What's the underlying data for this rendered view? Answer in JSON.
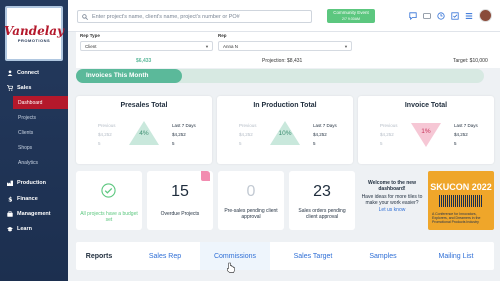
{
  "brand": {
    "logo_line1": "Vandelay",
    "logo_line2": "PROMOTIONS"
  },
  "sidebar": {
    "items": [
      {
        "label": "Connect",
        "icon": "user-icon"
      },
      {
        "label": "Sales",
        "icon": "cart-icon"
      },
      {
        "label": "Production",
        "icon": "factory-icon"
      },
      {
        "label": "Finance",
        "icon": "dollar-icon"
      },
      {
        "label": "Management",
        "icon": "briefcase-icon"
      },
      {
        "label": "Learn",
        "icon": "graduation-icon"
      }
    ],
    "sales_sub": [
      "Dashboard",
      "Projects",
      "Clients",
      "Shops",
      "Analytics"
    ]
  },
  "topbar": {
    "search_placeholder": "Enter project's name, client's name, project's number or PO#",
    "event_button": "Community Event",
    "event_sub": "2/7 9:30AM"
  },
  "filters": {
    "rep_type_label": "Rep Type",
    "rep_type_value": "Client",
    "rep_label": "Rep",
    "rep_value": "Anna N",
    "amount_left": "$6,433",
    "projection": "Projection: $8,431",
    "target": "Target: $10,000"
  },
  "progress": {
    "label": "Invoices This Month",
    "value": 0.26
  },
  "summary": [
    {
      "title": "Presales Total",
      "prev_label": "Previous",
      "prev_amount": "$4,252",
      "prev_count": "5",
      "last_label": "Last 7 Days",
      "last_amount": "$4,252",
      "last_count": "5",
      "pct": "4%",
      "trend": "up"
    },
    {
      "title": "In Production Total",
      "prev_label": "Previous",
      "prev_amount": "$4,252",
      "prev_count": "5",
      "last_label": "Last 7 Days",
      "last_amount": "$4,252",
      "last_count": "5",
      "pct": "10%",
      "trend": "up"
    },
    {
      "title": "Invoice Total",
      "prev_label": "Previous",
      "prev_amount": "$4,252",
      "prev_count": "5",
      "last_label": "Last 7 Days",
      "last_amount": "$4,252",
      "last_count": "5",
      "pct": "1%",
      "trend": "down"
    }
  ],
  "kpis": [
    {
      "value": "",
      "caption": "All projects have a budget set"
    },
    {
      "value": "15",
      "caption": "Overdue Projects"
    },
    {
      "value": "0",
      "caption": "Pre-sales pending client approval"
    },
    {
      "value": "23",
      "caption": "Sales orders pending client approval"
    }
  ],
  "welcome": {
    "title": "Welcome to the new dashboard!",
    "body": "Have ideas for more tiles to make your work easier?",
    "link": "Let us know"
  },
  "promo": {
    "title": "SKUCON 2022",
    "desc": "A Conference for Innovators, Explorers, and Dreamers in the Promotional Products Industry"
  },
  "reports": {
    "tabs": [
      "Reports",
      "Sales Rep",
      "Commissions",
      "Sales Target",
      "Samples",
      "Mailing List"
    ]
  },
  "colors": {
    "sidebar": "#243a5e",
    "accent": "#b4182b",
    "green": "#5bb99a",
    "link": "#2f6fd6"
  }
}
